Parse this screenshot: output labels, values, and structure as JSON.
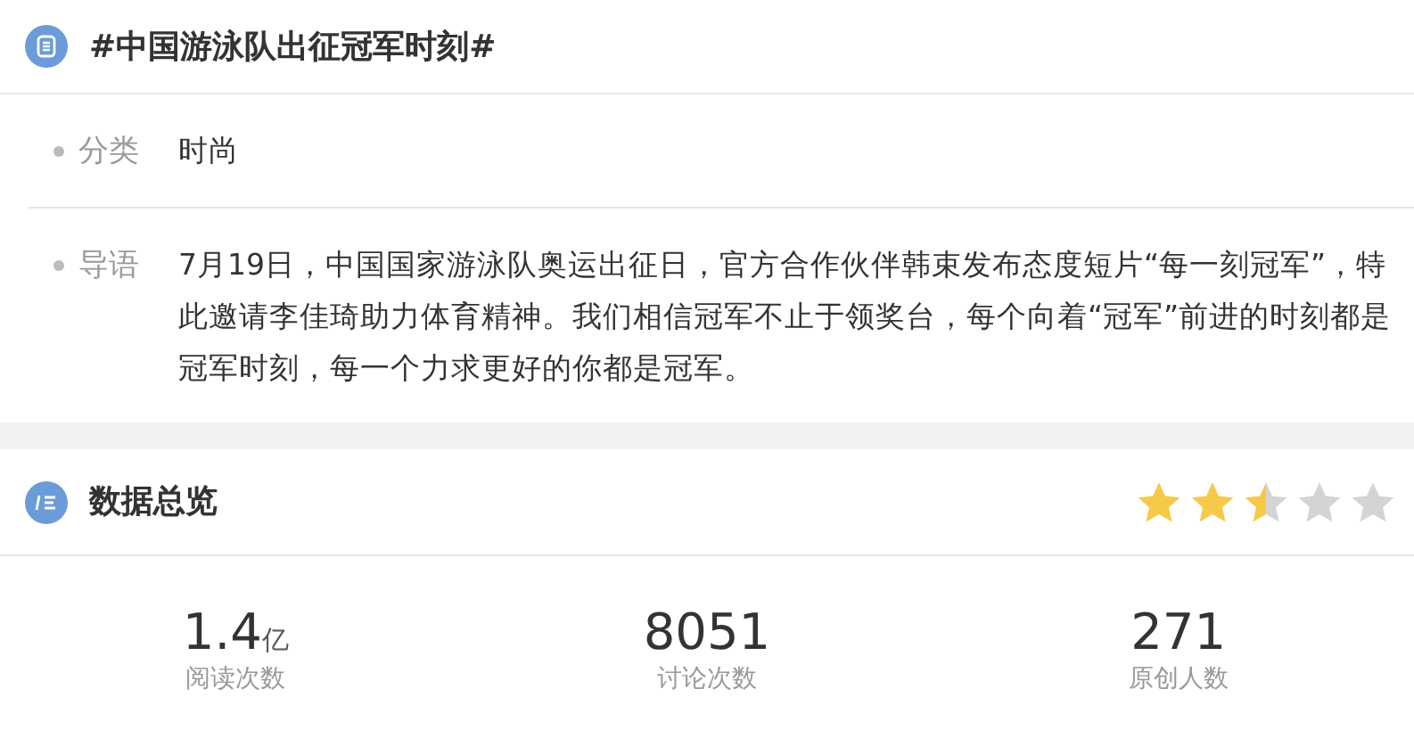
{
  "topic": {
    "title": "#中国游泳队出征冠军时刻#"
  },
  "details": [
    {
      "label": "分类",
      "value": "时尚"
    },
    {
      "label": "导语",
      "value": "7月19日，中国国家游泳队奥运出征日，官方合作伙伴韩束发布态度短片“每一刻冠军”，特此邀请李佳琦助力体育精神。我们相信冠军不止于领奖台，每个向着“冠军”前进的时刻都是冠军时刻，每一个力求更好的你都是冠军。"
    }
  ],
  "overview": {
    "title": "数据总览",
    "stars": 2.5,
    "stats": [
      {
        "value": "1.4",
        "unit": "亿",
        "label": "阅读次数"
      },
      {
        "value": "8051",
        "label": "讨论次数"
      },
      {
        "value": "271",
        "label": "原创人数"
      }
    ]
  }
}
